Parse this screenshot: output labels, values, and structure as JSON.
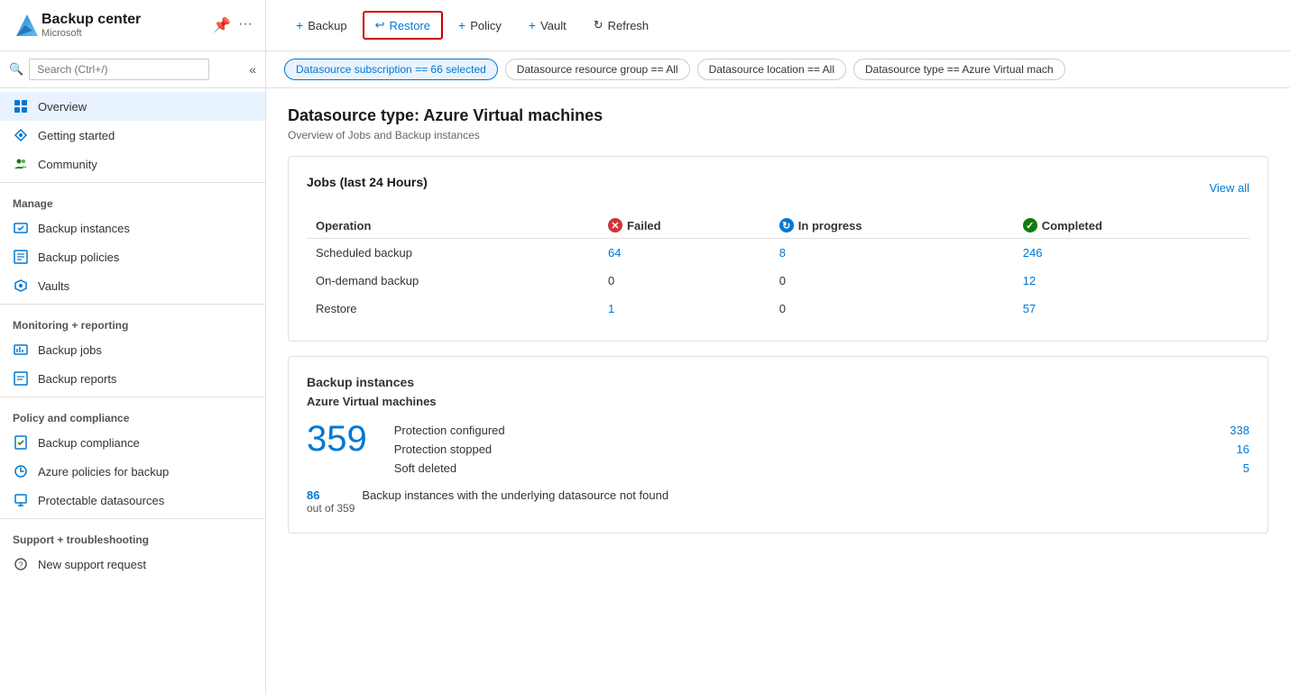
{
  "sidebar": {
    "title": "Backup center",
    "subtitle": "Microsoft",
    "search_placeholder": "Search (Ctrl+/)",
    "nav": {
      "overview": "Overview",
      "getting_started": "Getting started",
      "community": "Community",
      "manage_label": "Manage",
      "backup_instances": "Backup instances",
      "backup_policies": "Backup policies",
      "vaults": "Vaults",
      "monitoring_label": "Monitoring + reporting",
      "backup_jobs": "Backup jobs",
      "backup_reports": "Backup reports",
      "policy_label": "Policy and compliance",
      "backup_compliance": "Backup compliance",
      "azure_policies": "Azure policies for backup",
      "protectable_datasources": "Protectable datasources",
      "support_label": "Support + troubleshooting",
      "new_support_request": "New support request"
    }
  },
  "toolbar": {
    "backup_label": "Backup",
    "restore_label": "Restore",
    "policy_label": "Policy",
    "vault_label": "Vault",
    "refresh_label": "Refresh"
  },
  "filters": {
    "subscription": "Datasource subscription == 66 selected",
    "resource_group": "Datasource resource group == All",
    "location": "Datasource location == All",
    "type": "Datasource type == Azure Virtual mach"
  },
  "page": {
    "title": "Datasource type: Azure Virtual machines",
    "subtitle": "Overview of Jobs and Backup instances"
  },
  "jobs_card": {
    "title": "Jobs (last 24 Hours)",
    "view_all": "View all",
    "col_operation": "Operation",
    "col_failed": "Failed",
    "col_inprogress": "In progress",
    "col_completed": "Completed",
    "rows": [
      {
        "operation": "Scheduled backup",
        "failed": "64",
        "inprogress": "8",
        "completed": "246"
      },
      {
        "operation": "On-demand backup",
        "failed": "0",
        "inprogress": "0",
        "completed": "12"
      },
      {
        "operation": "Restore",
        "failed": "1",
        "inprogress": "0",
        "completed": "57"
      }
    ]
  },
  "backup_instances_card": {
    "title": "Backup instances",
    "subtitle": "Azure Virtual machines",
    "total": "359",
    "details": [
      {
        "label": "Protection configured",
        "value": "338"
      },
      {
        "label": "Protection stopped",
        "value": "16"
      },
      {
        "label": "Soft deleted",
        "value": "5"
      }
    ],
    "footer_count": "86",
    "footer_sublabel": "out of 359",
    "footer_note": "Backup instances with the underlying datasource not found"
  }
}
